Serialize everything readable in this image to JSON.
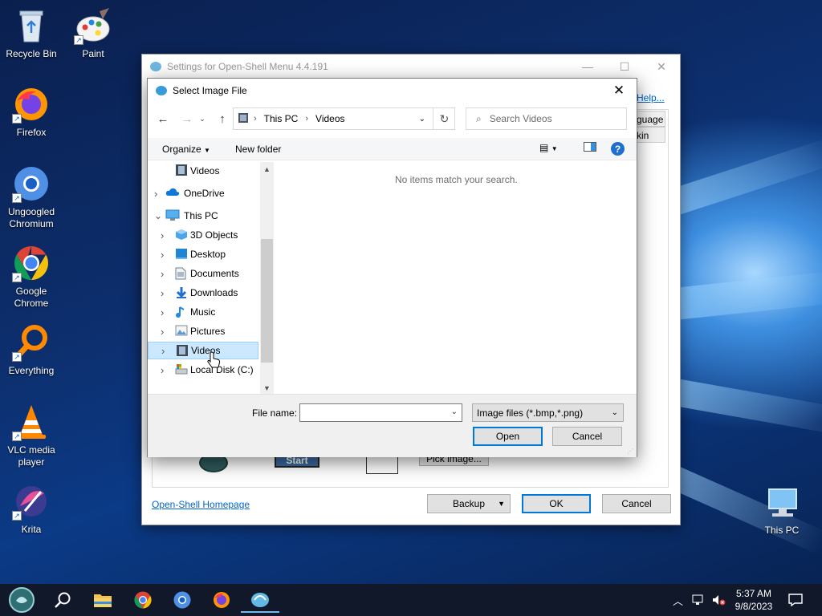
{
  "desktop": {
    "icons": [
      {
        "label": "Recycle Bin",
        "icon": "recycle-bin-icon"
      },
      {
        "label": "Paint",
        "icon": "paint-icon"
      },
      {
        "label": "Firefox",
        "icon": "firefox-icon"
      },
      {
        "label": "Ungoogled Chromium",
        "icon": "chromium-icon"
      },
      {
        "label": "Google Chrome",
        "icon": "chrome-icon"
      },
      {
        "label": "Everything",
        "icon": "everything-icon"
      },
      {
        "label": "VLC media player",
        "icon": "vlc-icon"
      },
      {
        "label": "Krita",
        "icon": "krita-icon"
      },
      {
        "label": "This PC",
        "icon": "this-pc-icon"
      }
    ]
  },
  "settings_window": {
    "title": "Settings for Open-Shell Menu 4.4.191",
    "help_link": "Help...",
    "column_language": "guage",
    "column_skin": "kin",
    "start_button_label": "Start",
    "pick_image_button": "Pick image...",
    "homepage_link": "Open-Shell Homepage",
    "backup_button": "Backup",
    "ok_button": "OK",
    "cancel_button": "Cancel"
  },
  "file_dialog": {
    "title": "Select Image File",
    "breadcrumb": [
      "This PC",
      "Videos"
    ],
    "search_placeholder": "Search Videos",
    "organize_label": "Organize",
    "new_folder_label": "New folder",
    "empty_message": "No items match your search.",
    "tree": [
      {
        "label": "Videos",
        "icon": "videos-icon",
        "level": 1,
        "expander": false,
        "selected": false
      },
      {
        "label": "OneDrive",
        "icon": "onedrive-icon",
        "level": 0,
        "expander": "collapsed",
        "selected": false
      },
      {
        "label": "This PC",
        "icon": "this-pc-icon",
        "level": 0,
        "expander": "expanded",
        "selected": false
      },
      {
        "label": "3D Objects",
        "icon": "3d-objects-icon",
        "level": 1,
        "expander": "collapsed",
        "selected": false
      },
      {
        "label": "Desktop",
        "icon": "desktop-folder-icon",
        "level": 1,
        "expander": "collapsed",
        "selected": false
      },
      {
        "label": "Documents",
        "icon": "documents-icon",
        "level": 1,
        "expander": "collapsed",
        "selected": false
      },
      {
        "label": "Downloads",
        "icon": "downloads-icon",
        "level": 1,
        "expander": "collapsed",
        "selected": false
      },
      {
        "label": "Music",
        "icon": "music-icon",
        "level": 1,
        "expander": "collapsed",
        "selected": false
      },
      {
        "label": "Pictures",
        "icon": "pictures-icon",
        "level": 1,
        "expander": "collapsed",
        "selected": false
      },
      {
        "label": "Videos",
        "icon": "videos-icon",
        "level": 1,
        "expander": "collapsed",
        "selected": true
      },
      {
        "label": "Local Disk (C:)",
        "icon": "local-disk-icon",
        "level": 1,
        "expander": "collapsed",
        "selected": false
      }
    ],
    "file_name_label": "File name:",
    "file_name_value": "",
    "file_type_selected": "Image files (*.bmp,*.png)",
    "open_button": "Open",
    "cancel_button": "Cancel"
  },
  "taskbar": {
    "apps": [
      "start-orb-icon",
      "search-icon",
      "file-explorer-icon",
      "chrome-icon",
      "chromium-icon",
      "firefox-icon",
      "open-shell-icon"
    ],
    "time": "5:37 AM",
    "date": "9/8/2023"
  },
  "colors": {
    "accent": "#0078d7",
    "selection": "#cce8ff",
    "taskbar": "#10182a"
  }
}
